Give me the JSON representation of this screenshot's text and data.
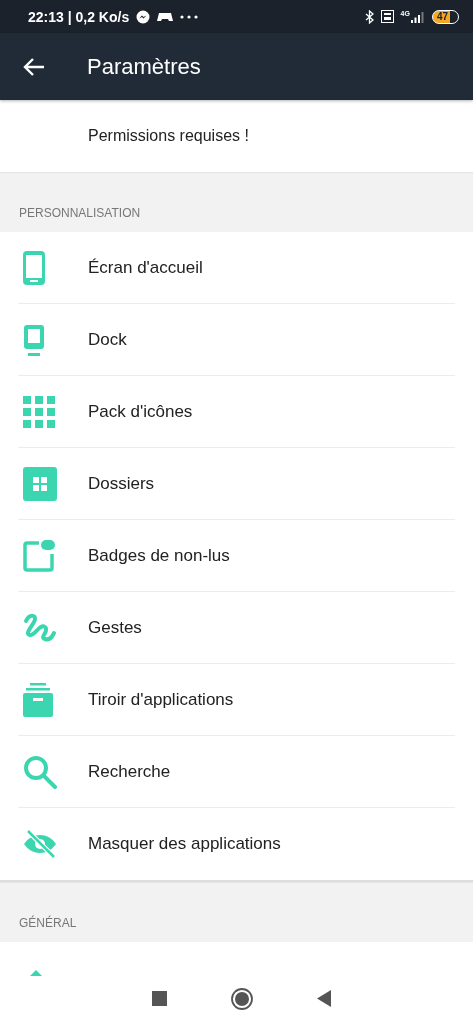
{
  "status_bar": {
    "time": "22:13 | 0,2 Ko/s",
    "network": "4G",
    "battery": "47"
  },
  "app_bar": {
    "title": "Paramètres"
  },
  "notice": "Permissions requises !",
  "sections": [
    {
      "header": "PERSONNALISATION",
      "items": [
        {
          "label": "Écran d'accueil",
          "kind": "phone"
        },
        {
          "label": "Dock",
          "kind": "dock"
        },
        {
          "label": "Pack d'icônes",
          "kind": "grid"
        },
        {
          "label": "Dossiers",
          "kind": "folder"
        },
        {
          "label": "Badges de non-lus",
          "kind": "badge"
        },
        {
          "label": "Gestes",
          "kind": "gesture"
        },
        {
          "label": "Tiroir d'applications",
          "kind": "drawer"
        },
        {
          "label": "Recherche",
          "kind": "search"
        },
        {
          "label": "Masquer des applications",
          "kind": "hide"
        }
      ]
    },
    {
      "header": "GÉNÉRAL"
    }
  ]
}
